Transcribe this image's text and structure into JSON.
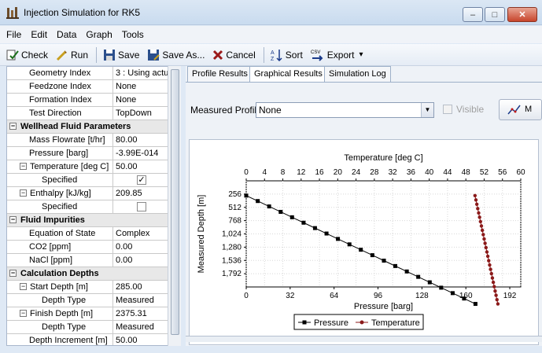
{
  "window": {
    "title": "Injection Simulation for RK5",
    "min_label": "–",
    "max_label": "□",
    "close_label": "✕"
  },
  "menu": [
    "File",
    "Edit",
    "Data",
    "Graph",
    "Tools"
  ],
  "toolbar": {
    "check": "Check",
    "run": "Run",
    "save": "Save",
    "save_as": "Save As...",
    "cancel": "Cancel",
    "sort": "Sort",
    "export": "Export",
    "export_caret": "▾"
  },
  "grid": {
    "rows": [
      {
        "type": "prop",
        "indent": 2,
        "label": "Geometry Index",
        "value": "3 : Using actu"
      },
      {
        "type": "prop",
        "indent": 2,
        "label": "Feedzone Index",
        "value": "None"
      },
      {
        "type": "prop",
        "indent": 2,
        "label": "Formation Index",
        "value": "None"
      },
      {
        "type": "prop",
        "indent": 2,
        "label": "Test Direction",
        "value": "TopDown"
      },
      {
        "type": "header",
        "label": "Wellhead Fluid Parameters",
        "expander": "−"
      },
      {
        "type": "prop",
        "indent": 2,
        "label": "Mass Flowrate [t/hr]",
        "value": "80.00"
      },
      {
        "type": "prop",
        "indent": 2,
        "label": "Pressure [barg]",
        "value": "-3.99E-014"
      },
      {
        "type": "prop",
        "indent": 1,
        "expander": "−",
        "label": "Temperature [deg C]",
        "value": "50.00"
      },
      {
        "type": "check",
        "indent": 3,
        "label": "Specified",
        "checked": true,
        "mark": "✓"
      },
      {
        "type": "prop",
        "indent": 1,
        "expander": "−",
        "label": "Enthalpy [kJ/kg]",
        "value": "209.85"
      },
      {
        "type": "check",
        "indent": 3,
        "label": "Specified",
        "checked": false,
        "mark": ""
      },
      {
        "type": "header",
        "label": "Fluid Impurities",
        "expander": "−"
      },
      {
        "type": "prop",
        "indent": 2,
        "label": "Equation of State",
        "value": "Complex"
      },
      {
        "type": "prop",
        "indent": 2,
        "label": "CO2 [ppm]",
        "value": "0.00"
      },
      {
        "type": "prop",
        "indent": 2,
        "label": "NaCl [ppm]",
        "value": "0.00"
      },
      {
        "type": "header",
        "label": "Calculation Depths",
        "expander": "−"
      },
      {
        "type": "prop",
        "indent": 1,
        "expander": "−",
        "label": "Start Depth [m]",
        "value": "285.00"
      },
      {
        "type": "prop",
        "indent": 3,
        "label": "Depth Type",
        "value": "Measured"
      },
      {
        "type": "prop",
        "indent": 1,
        "expander": "−",
        "label": "Finish Depth [m]",
        "value": "2375.31"
      },
      {
        "type": "prop",
        "indent": 3,
        "label": "Depth Type",
        "value": "Measured"
      },
      {
        "type": "prop",
        "indent": 2,
        "label": "Depth Increment [m]",
        "value": "50.00"
      }
    ]
  },
  "tabs": [
    "Profile Results",
    "Graphical Results",
    "Simulation Log"
  ],
  "active_tab": 1,
  "measured_profile": {
    "label": "Measured Profile",
    "value": "None",
    "arrow": "▼",
    "visible_label": "Visible",
    "button_label": "M"
  },
  "chart_data": {
    "type": "line",
    "x_top": {
      "label": "Temperature [deg C]",
      "ticks": [
        "0",
        "4",
        "8",
        "12",
        "16",
        "20",
        "24",
        "28",
        "32",
        "36",
        "40",
        "44",
        "48",
        "52",
        "56",
        "60"
      ],
      "lim": [
        0,
        60
      ]
    },
    "x_bottom": {
      "label": "Pressure [barg]",
      "ticks": [
        "0",
        "32",
        "64",
        "96",
        "128",
        "160",
        "192"
      ],
      "lim": [
        0,
        200
      ]
    },
    "y": {
      "label": "Measured Depth [m]",
      "ticks": [
        "256",
        "512",
        "768",
        "1,024",
        "1,280",
        "1,536",
        "1,792"
      ],
      "lim": [
        285,
        2375
      ],
      "inverted": true
    },
    "grid": true,
    "legend": "bottom-center",
    "series": [
      {
        "name": "Pressure",
        "axis": "bottom",
        "color": "#000000",
        "marker": "square",
        "x": [
          0,
          8.4,
          16.7,
          25.1,
          33.4,
          41.8,
          50.1,
          58.5,
          66.8,
          75.2,
          83.5,
          91.9,
          100.3,
          108.6,
          117,
          125.3,
          133.7,
          142,
          150.4,
          158.7,
          167
        ],
        "y": [
          285,
          390,
          494,
          599,
          703,
          808,
          912,
          1017,
          1121,
          1226,
          1330,
          1435,
          1540,
          1644,
          1749,
          1853,
          1958,
          2062,
          2167,
          2271,
          2375
        ]
      },
      {
        "name": "Temperature",
        "axis": "top",
        "color": "#8b1a1a",
        "marker": "circle",
        "x": [
          50.0,
          50.2,
          50.4,
          50.6,
          50.8,
          51.0,
          51.2,
          51.4,
          51.6,
          51.8,
          52.0,
          52.2,
          52.4,
          52.6,
          52.8,
          53.0,
          53.2,
          53.4,
          53.6,
          53.8,
          54.0,
          54.2,
          54.4,
          54.6,
          54.8,
          55.0
        ],
        "y": [
          285,
          369,
          452,
          536,
          620,
          703,
          787,
          871,
          954,
          1038,
          1122,
          1205,
          1289,
          1373,
          1456,
          1540,
          1624,
          1708,
          1791,
          1875,
          1958,
          2042,
          2126,
          2209,
          2293,
          2375
        ]
      }
    ]
  }
}
